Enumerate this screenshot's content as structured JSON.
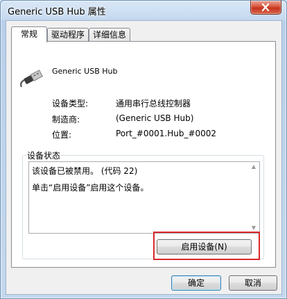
{
  "window": {
    "title": "Generic USB Hub 属性"
  },
  "tabs": [
    {
      "label": "常规",
      "active": true
    },
    {
      "label": "驱动程序",
      "active": false
    },
    {
      "label": "详细信息",
      "active": false
    }
  ],
  "device": {
    "name": "Generic USB Hub",
    "icon": "usb-connector-icon",
    "properties": [
      {
        "label": "设备类型:",
        "value": "通用串行总线控制器"
      },
      {
        "label": "制造商:",
        "value": "(Generic USB Hub)"
      },
      {
        "label": "位置:",
        "value": "Port_#0001.Hub_#0002"
      }
    ]
  },
  "status": {
    "group_label": "设备状态",
    "lines": [
      "该设备已被禁用。 (代码 22)",
      "单击“启用设备”启用这个设备。"
    ],
    "enable_button": "启用设备(N)"
  },
  "footer": {
    "ok": "确定",
    "cancel": "取消"
  },
  "colors": {
    "highlight": "#d7282b",
    "close_button": "#c4331c"
  }
}
